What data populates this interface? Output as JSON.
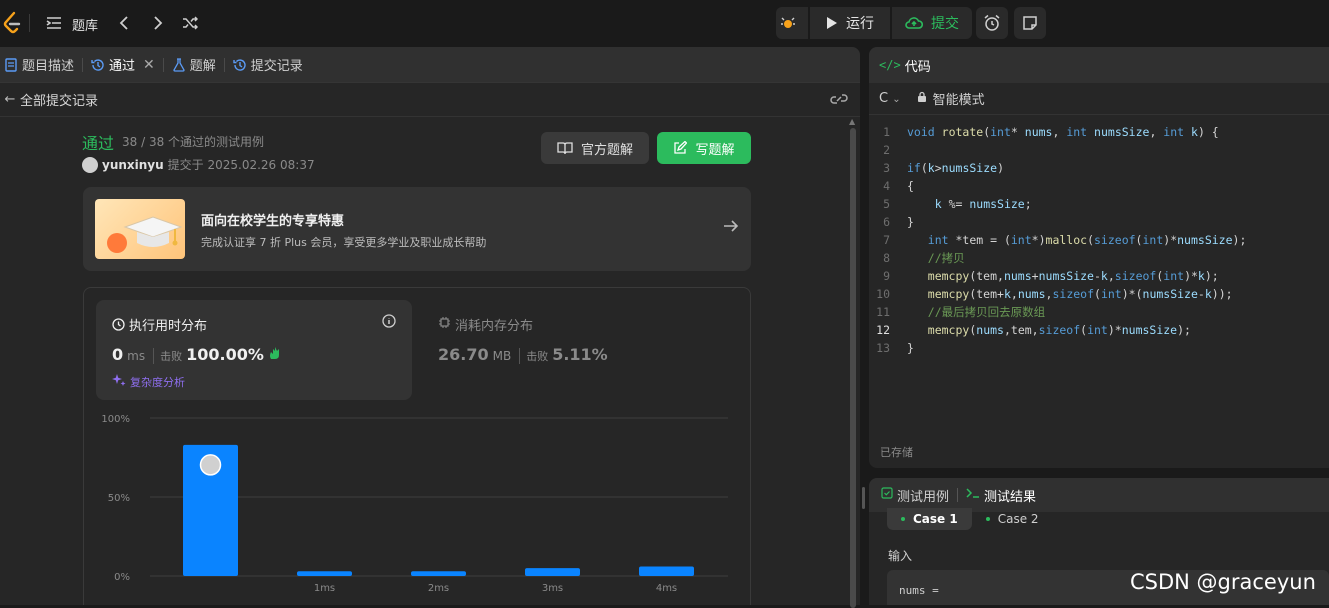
{
  "topbar": {
    "title": "题库",
    "run_label": "运行",
    "submit_label": "提交"
  },
  "tabs": [
    {
      "label": "题目描述"
    },
    {
      "label": "通过"
    },
    {
      "label": "题解"
    },
    {
      "label": "提交记录"
    }
  ],
  "subbar": {
    "title": "全部提交记录"
  },
  "result": {
    "status": "通过",
    "count": "38 / 38 个通过的测试用例",
    "user": "yunxinyu",
    "submitted_at": "提交于 2025.02.26 08:37",
    "official_solution_label": "官方题解",
    "write_solution_label": "写题解"
  },
  "promo": {
    "title": "面向在校学生的专享特惠",
    "subtitle": "完成认证享 7 折 Plus 会员，享受更多学业及职业成长帮助"
  },
  "stats": {
    "time": {
      "title": "执行用时分布",
      "value": "0",
      "unit": "ms",
      "beat_label": "击败",
      "beat_pct": "100.00%",
      "complexity_label": "复杂度分析"
    },
    "memory": {
      "title": "消耗内存分布",
      "value": "26.70",
      "unit": "MB",
      "beat_label": "击败",
      "beat_pct": "5.11%"
    }
  },
  "chart_data": {
    "type": "bar",
    "categories": [
      "0ms",
      "1ms",
      "2ms",
      "3ms",
      "4ms"
    ],
    "x_tick_labels": [
      "",
      "1ms",
      "2ms",
      "3ms",
      "4ms"
    ],
    "values": [
      83,
      3,
      3,
      5,
      6
    ],
    "ylim": [
      0,
      100
    ],
    "y_ticks": [
      "100%",
      "50%",
      "0%"
    ],
    "y_tick_values": [
      100,
      50,
      0
    ],
    "bar_color": "#0a84ff",
    "highlight_index": 0,
    "grid": true
  },
  "code_panel": {
    "title": "代码",
    "language": "C",
    "mode": "智能模式",
    "saved": "已存储",
    "lines": [
      {
        "n": "1",
        "text": "void rotate(int* nums, int numsSize, int k) {"
      },
      {
        "n": "2",
        "text": ""
      },
      {
        "n": "3",
        "text": "if(k>numsSize)"
      },
      {
        "n": "4",
        "text": "{"
      },
      {
        "n": "5",
        "text": "    k %= numsSize;"
      },
      {
        "n": "6",
        "text": "}"
      },
      {
        "n": "7",
        "text": "   int *tem = (int*)malloc(sizeof(int)*numsSize);"
      },
      {
        "n": "8",
        "text": "   //拷贝"
      },
      {
        "n": "9",
        "text": "   memcpy(tem,nums+numsSize-k,sizeof(int)*k);"
      },
      {
        "n": "10",
        "text": "   memcpy(tem+k,nums,sizeof(int)*(numsSize-k));"
      },
      {
        "n": "11",
        "text": "   //最后拷贝回去原数组"
      },
      {
        "n": "12",
        "text": "   memcpy(nums,tem,sizeof(int)*numsSize);"
      },
      {
        "n": "13",
        "text": "}"
      }
    ]
  },
  "test_panel": {
    "tab_cases": "测试用例",
    "tab_results": "测试结果",
    "case1": "Case 1",
    "case2": "Case 2",
    "input_label": "输入",
    "input_value": "nums ="
  },
  "watermark": "CSDN @graceyun",
  "colors": {
    "accent_green": "#2cbb5d",
    "bar_blue": "#0a84ff",
    "purple": "#8f6ff0"
  }
}
